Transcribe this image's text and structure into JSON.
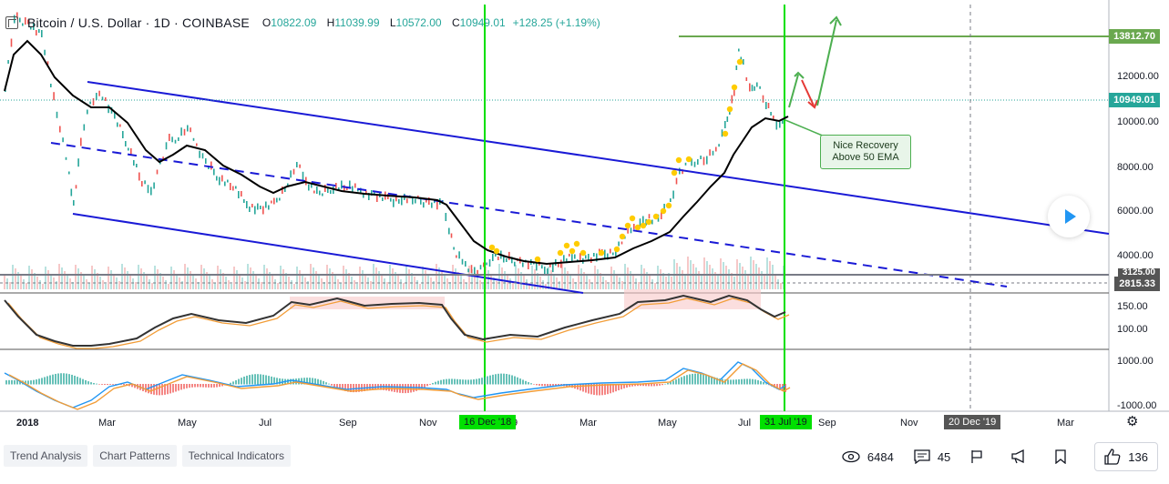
{
  "legend": {
    "symbol": "Bitcoin / U.S. Dollar · 1D · COINBASE",
    "open_label": "O",
    "open": "10822.09",
    "high_label": "H",
    "high": "11039.99",
    "low_label": "L",
    "low": "10572.00",
    "close_label": "C",
    "close": "10949.01",
    "change": "+128.25 (+1.19%)"
  },
  "price_axis": {
    "ticks": [
      "12000.00",
      "10000.00",
      "8000.00",
      "6000.00",
      "4000.00"
    ],
    "tag_top": "13812.70",
    "tag_current": "10949.01",
    "tag_low1": "3125.00",
    "tag_low2": "2815.33"
  },
  "indicator1_axis": [
    "150.00",
    "100.00"
  ],
  "indicator2_axis": [
    "1000.00",
    "-1000.00"
  ],
  "time_axis": [
    "2018",
    "Mar",
    "May",
    "Jul",
    "Sep",
    "Nov",
    "9",
    "Mar",
    "May",
    "Jul",
    "Sep",
    "Nov",
    "Mar"
  ],
  "date_tags": {
    "dec18": "16 Dec '18",
    "jul19": "31 Jul '19",
    "dec19": "20 Dec '19"
  },
  "annotation": "Nice Recovery Above 50 EMA",
  "annotation_lines": [
    "Nice Recovery",
    "Above 50 EMA"
  ],
  "footer": {
    "tags": [
      "Trend Analysis",
      "Chart Patterns",
      "Technical Indicators"
    ],
    "views": "6484",
    "comments": "45",
    "likes": "136"
  },
  "colors": {
    "up": "#26a69a",
    "down": "#ef5350",
    "channel": "#1a1ad6",
    "vertical_line": "#00e000",
    "target_line": "#6aa84f",
    "ema": "#000000",
    "marker": "#ffcc00"
  },
  "chart_data": {
    "type": "candlestick",
    "title": "Bitcoin / U.S. Dollar · 1D · COINBASE",
    "annotations": [
      "Nice Recovery Above 50 EMA"
    ],
    "levels": [
      13812.7,
      10949.01,
      3125.0,
      2815.33
    ],
    "ylim": [
      3000,
      14000
    ]
  }
}
